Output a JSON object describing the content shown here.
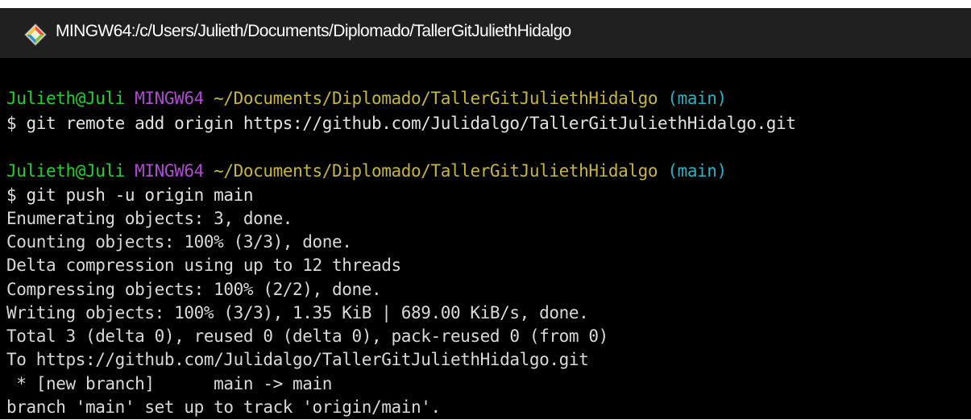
{
  "window": {
    "title": "MINGW64:/c/Users/Julieth/Documents/Diplomado/TallerGitJuliethHidalgo",
    "icon": "git-bash-diamond-icon"
  },
  "colors": {
    "user_host": "#23d12c",
    "system": "#b04ad3",
    "path": "#c6b63e",
    "branch": "#27b2c6",
    "text": "#d9d9d9",
    "background": "#000000",
    "titlebar": "#202020"
  },
  "terminal": {
    "prompts": [
      {
        "user_host": "Julieth@Juli",
        "system": "MINGW64",
        "path": "~/Documents/Diplomado/TallerGitJuliethHidalgo",
        "branch": "(main)",
        "command": "$ git remote add origin https://github.com/Julidalgo/TallerGitJuliethHidalgo.git"
      },
      {
        "user_host": "Julieth@Juli",
        "system": "MINGW64",
        "path": "~/Documents/Diplomado/TallerGitJuliethHidalgo",
        "branch": "(main)",
        "command": "$ git push -u origin main"
      }
    ],
    "output": [
      "Enumerating objects: 3, done.",
      "Counting objects: 100% (3/3), done.",
      "Delta compression using up to 12 threads",
      "Compressing objects: 100% (2/2), done.",
      "Writing objects: 100% (3/3), 1.35 KiB | 689.00 KiB/s, done.",
      "Total 3 (delta 0), reused 0 (delta 0), pack-reused 0 (from 0)",
      "To https://github.com/Julidalgo/TallerGitJuliethHidalgo.git",
      " * [new branch]      main -> main",
      "branch 'main' set up to track 'origin/main'."
    ]
  }
}
